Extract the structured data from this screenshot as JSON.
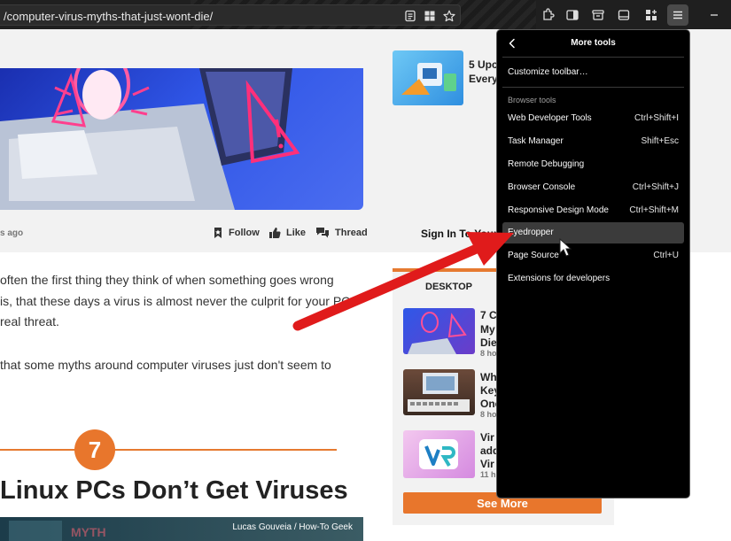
{
  "browser": {
    "url": "/computer-virus-myths-that-just-wont-die/"
  },
  "article": {
    "time_ago": "s ago",
    "follow_label": "Follow",
    "like_label": "Like",
    "thread_label": "Thread",
    "paragraph_lines": [
      "often the first thing they think of when something goes wrong",
      "is, that these days a virus is almost never the culprit for your PC",
      "real threat."
    ],
    "paragraph2": " that some myths around computer viruses just don't seem to",
    "section_number": "7",
    "section_heading": "Linux PCs Don’t Get Viruses",
    "image_credit": "Lucas Gouveia / How-To Geek"
  },
  "sidebar": {
    "top_title_lines": [
      "5 Upc",
      "Every"
    ],
    "signin_text": "Sign In To Your",
    "section_label": "DESKTOP",
    "items": [
      {
        "title_lines": [
          "7 C",
          "My",
          "Die"
        ],
        "time": "8 ho"
      },
      {
        "title_lines": [
          "Wh",
          "Key",
          "One"
        ],
        "time": "8 ho"
      },
      {
        "title_lines": [
          "Vir",
          "add",
          "Vir"
        ],
        "time": "11 h"
      }
    ],
    "see_more_label": "See More"
  },
  "more_tools_panel": {
    "title": "More tools",
    "customize": "Customize toolbar…",
    "section_label": "Browser tools",
    "items": [
      {
        "label": "Web Developer Tools",
        "shortcut": "Ctrl+Shift+I"
      },
      {
        "label": "Task Manager",
        "shortcut": "Shift+Esc"
      },
      {
        "label": "Remote Debugging",
        "shortcut": ""
      },
      {
        "label": "Browser Console",
        "shortcut": "Ctrl+Shift+J"
      },
      {
        "label": "Responsive Design Mode",
        "shortcut": "Ctrl+Shift+M"
      },
      {
        "label": "Eyedropper",
        "shortcut": ""
      },
      {
        "label": "Page Source",
        "shortcut": "Ctrl+U"
      },
      {
        "label": "Extensions for developers",
        "shortcut": ""
      }
    ],
    "highlighted_item": "Eyedropper"
  },
  "colors": {
    "accent_orange": "#e8762c",
    "annotation_arrow": "#e01b1b",
    "panel_background": "#000000"
  }
}
